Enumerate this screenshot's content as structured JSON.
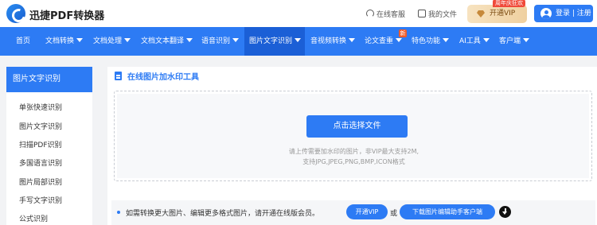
{
  "header": {
    "brand": "迅捷PDF转换器",
    "service_label": "在线客服",
    "docs_label": "我的文件",
    "vip_label": "开通VIP",
    "promo_badge": "周年庆狂欢",
    "login_label": "登录 | 注册"
  },
  "nav": {
    "items": [
      {
        "label": "首页"
      },
      {
        "label": "文档转换"
      },
      {
        "label": "文档处理"
      },
      {
        "label": "文档文本翻译"
      },
      {
        "label": "语音识别"
      },
      {
        "label": "图片文字识别"
      },
      {
        "label": "音视频转换"
      },
      {
        "label": "论文查重"
      },
      {
        "label": "特色功能"
      },
      {
        "label": "AI工具"
      },
      {
        "label": "客户端"
      }
    ],
    "new_badge": "新"
  },
  "sidebar": {
    "title": "图片文字识别",
    "items": [
      {
        "label": "单张快速识别"
      },
      {
        "label": "图片文字识别"
      },
      {
        "label": "扫描PDF识别"
      },
      {
        "label": "多国语言识别"
      },
      {
        "label": "图片局部识别"
      },
      {
        "label": "手写文字识别"
      },
      {
        "label": "公式识别"
      }
    ]
  },
  "main": {
    "section_title": "在线图片加水印工具",
    "upload_button": "点击选择文件",
    "hint_line1": "请上传需要加水印的图片，非VIP最大支持2M,",
    "hint_line2": "支持JPG,JPEG,PNG,BMP,ICON格式",
    "tip_text": "如需转换更大图片、编辑更多格式图片，请开通在线版会员。",
    "vip_button": "开通VIP",
    "or_text": "或",
    "download_button": "下载图片编辑助手客户端"
  },
  "colors": {
    "primary": "#2d7bf4",
    "nav_active": "#1b5fd6",
    "vip_gold": "#efd0a0",
    "promo_red": "#f04a3a"
  },
  "icons": [
    "logo-icon",
    "headset-icon",
    "document-icon",
    "diamond-icon",
    "user-icon",
    "chevron-down-icon",
    "file-icon",
    "download-icon"
  ]
}
